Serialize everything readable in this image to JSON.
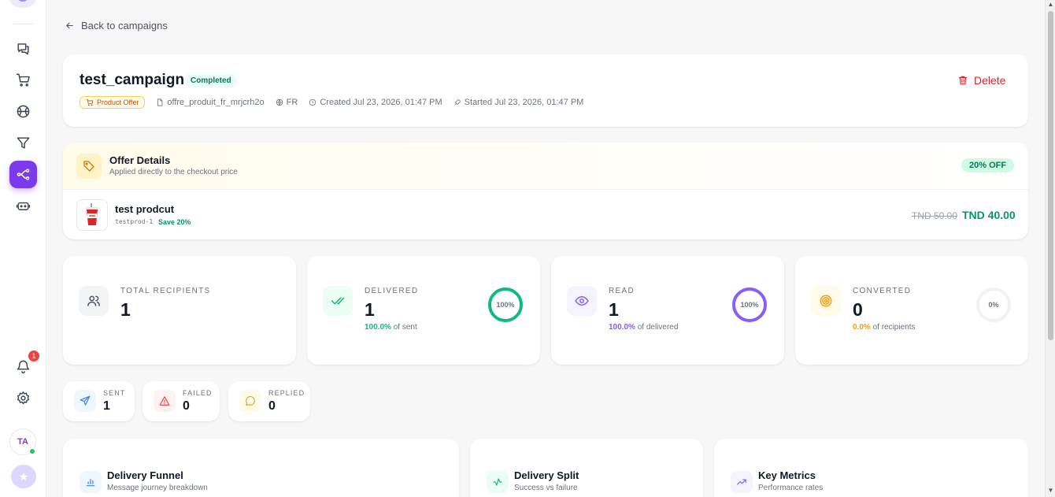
{
  "sidebar": {
    "notification_count": "1",
    "user_initials": "TA"
  },
  "nav": {
    "back_label": "Back to campaigns"
  },
  "campaign": {
    "title": "test_campaign",
    "status": "Completed",
    "offer_type": "Product Offer",
    "template": "offre_produit_fr_mrjcrh2o",
    "language": "FR",
    "created": "Created Jul 23, 2026, 01:47 PM",
    "started": "Started Jul 23, 2026, 01:47 PM",
    "delete_label": "Delete"
  },
  "offer": {
    "title": "Offer Details",
    "subtitle": "Applied directly to the checkout price",
    "discount_badge": "20% OFF",
    "product_name": "test prodcut",
    "product_sku": "testprod-1",
    "product_save": "Save 20%",
    "old_price": "TND 50.00",
    "new_price": "TND 40.00"
  },
  "stats": [
    {
      "label": "TOTAL RECIPIENTS",
      "value": "1",
      "icon": "users-icon",
      "color": "#4b5563",
      "bg": "#f3f4f6"
    },
    {
      "label": "DELIVERED",
      "value": "1",
      "pct": "100.0%",
      "suffix": " of sent",
      "ring_label": "100%",
      "ring_fraction": 1.0,
      "icon": "check-double-icon",
      "color": "#10b981",
      "bg": "#ecfdf5"
    },
    {
      "label": "READ",
      "value": "1",
      "pct": "100.0%",
      "suffix": " of delivered",
      "ring_label": "100%",
      "ring_fraction": 1.0,
      "icon": "eye-icon",
      "color": "#8b5cf6",
      "bg": "#f5f3ff"
    },
    {
      "label": "CONVERTED",
      "value": "0",
      "pct": "0.0%",
      "suffix": " of recipients",
      "ring_label": "0%",
      "ring_fraction": 0.0,
      "icon": "target-icon",
      "color": "#f59e0b",
      "bg": "#fffbeb"
    }
  ],
  "mini_stats": [
    {
      "label": "SENT",
      "value": "1",
      "icon": "send-icon",
      "color": "#3b82f6",
      "bg": "#eff6ff"
    },
    {
      "label": "FAILED",
      "value": "0",
      "icon": "alert-triangle-icon",
      "color": "#ef4444",
      "bg": "#fef2f2"
    },
    {
      "label": "REPLIED",
      "value": "0",
      "icon": "message-circle-icon",
      "color": "#f59e0b",
      "bg": "#fffbeb"
    }
  ],
  "panels": [
    {
      "title": "Delivery Funnel",
      "subtitle": "Message journey breakdown",
      "icon": "bar-chart-icon",
      "color": "#3b82f6",
      "bg": "#eff6ff"
    },
    {
      "title": "Delivery Split",
      "subtitle": "Success vs failure",
      "icon": "activity-icon",
      "color": "#10b981",
      "bg": "#ecfdf5"
    },
    {
      "title": "Key Metrics",
      "subtitle": "Performance rates",
      "icon": "trending-up-icon",
      "color": "#8b5cf6",
      "bg": "#f5f3ff"
    }
  ]
}
